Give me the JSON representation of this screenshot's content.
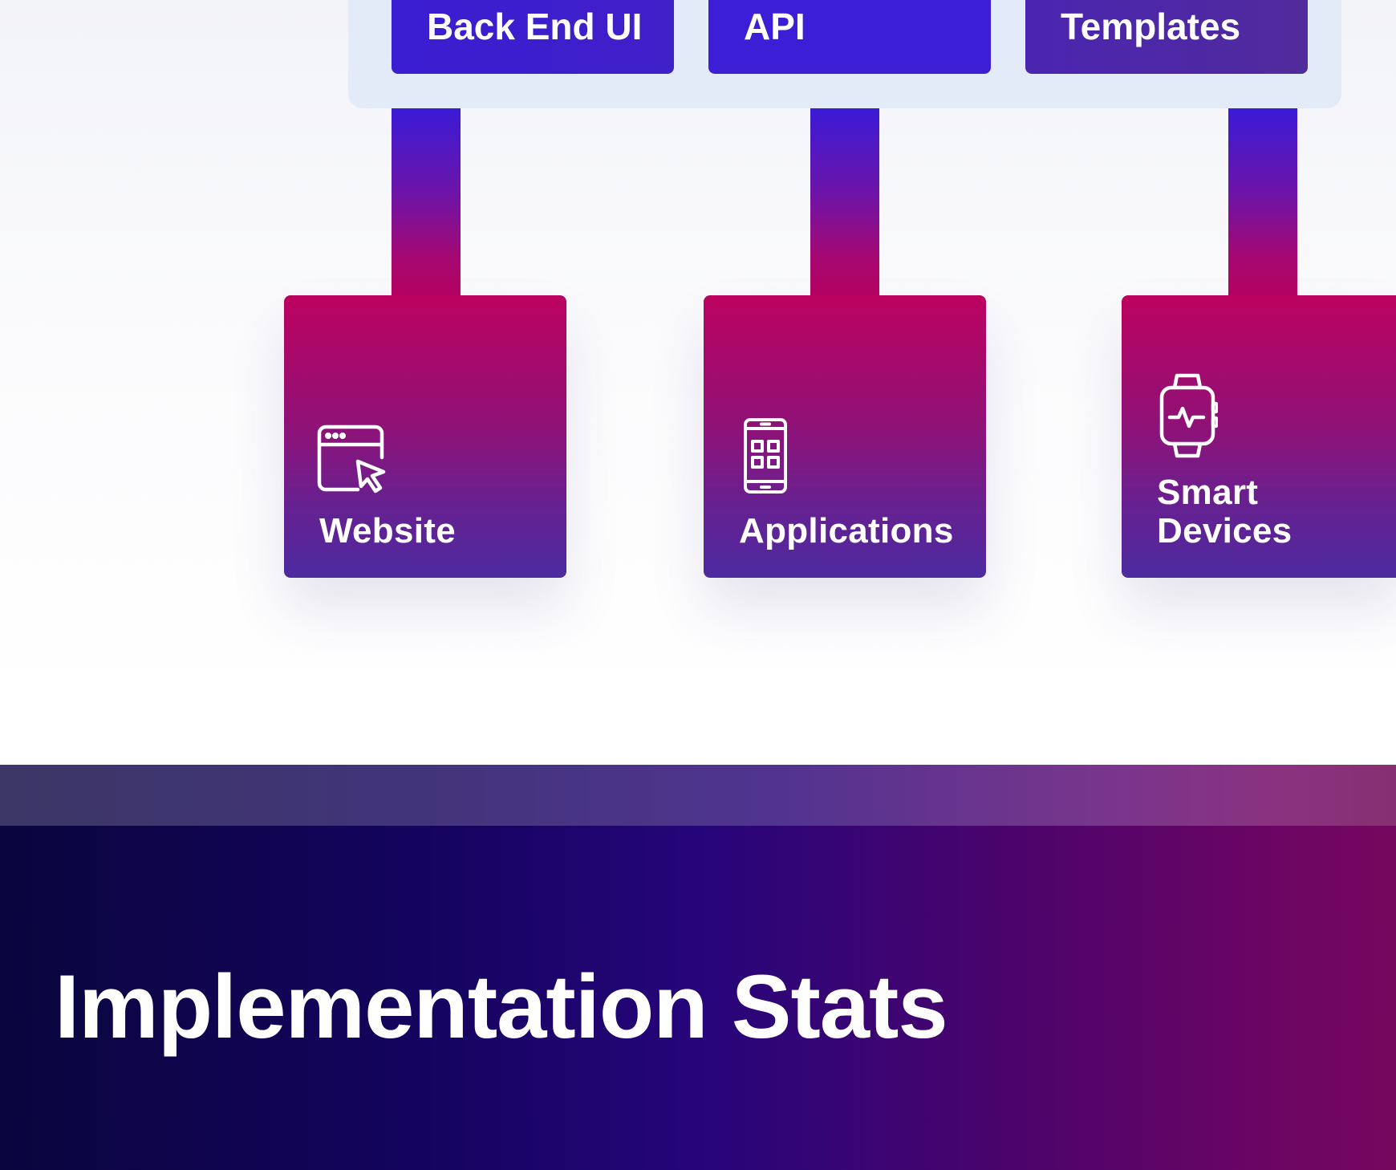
{
  "diagram": {
    "top_buttons": [
      {
        "label": "Back End UI"
      },
      {
        "label": "API"
      },
      {
        "label": "Templates"
      }
    ],
    "cards": [
      {
        "icon": "browser-cursor-icon",
        "label_lines": [
          "Website"
        ]
      },
      {
        "icon": "mobile-app-icon",
        "label_lines": [
          "Applications"
        ]
      },
      {
        "icon": "smartwatch-icon",
        "label_lines": [
          "Smart",
          "Devices"
        ]
      }
    ]
  },
  "stats": {
    "title": "Implementation Stats"
  },
  "colors": {
    "button_blue": "#3b1ed6",
    "card_top": "#bc025f",
    "card_bottom": "#4c2aa0",
    "stats_dark": "#0a053e",
    "stats_magenta": "#76075e"
  }
}
